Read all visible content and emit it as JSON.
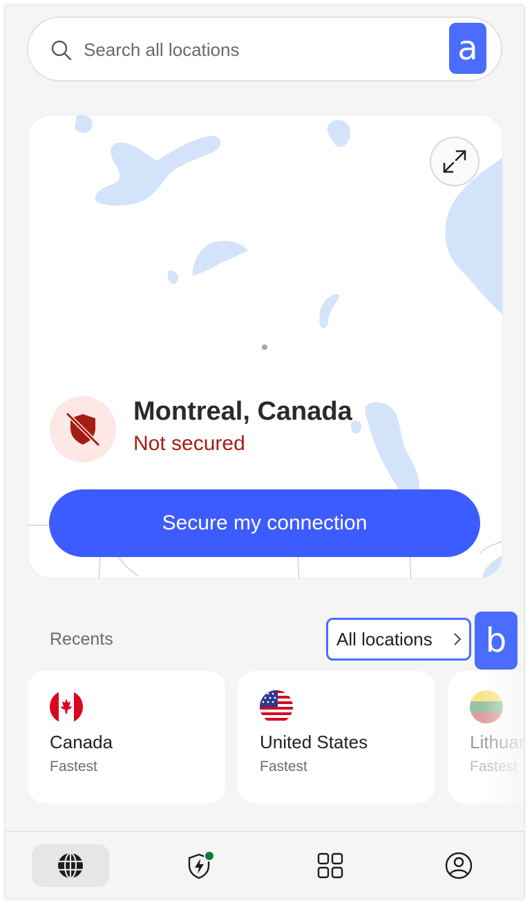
{
  "search": {
    "placeholder": "Search all locations"
  },
  "annotations": {
    "a": "a",
    "b": "b"
  },
  "connection": {
    "location": "Montreal, Canada",
    "status": "Not secured",
    "button_label": "Secure my connection"
  },
  "recents": {
    "label": "Recents",
    "all_locations_label": "All locations",
    "items": [
      {
        "name": "Canada",
        "sub": "Fastest",
        "flag": "canada-flag"
      },
      {
        "name": "United States",
        "sub": "Fastest",
        "flag": "us-flag"
      },
      {
        "name": "Lithuania",
        "sub": "Fastest",
        "flag": "lithuania-flag"
      }
    ]
  },
  "nav": [
    "globe-icon",
    "shield-bolt-icon",
    "grid-icon",
    "account-icon"
  ],
  "colors": {
    "accent": "#3d5cff",
    "danger": "#a41d12",
    "map_water": "#d3e3fa"
  }
}
